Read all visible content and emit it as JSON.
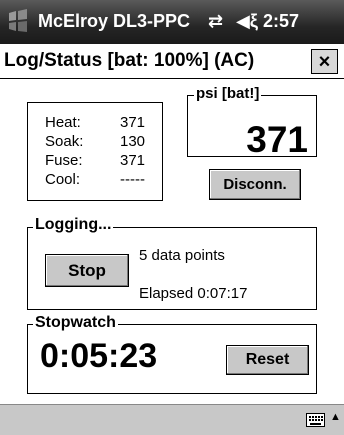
{
  "titlebar": {
    "title": "McElroy DL3-PPC",
    "connection_icon": "⇄",
    "volume_icon": "◀ξ",
    "time": "2:57"
  },
  "header": {
    "title": "Log/Status  [bat: 100%] (AC)",
    "close_label": "×"
  },
  "stats": [
    {
      "label": "Heat:",
      "value": "371"
    },
    {
      "label": "Soak:",
      "value": "130"
    },
    {
      "label": "Fuse:",
      "value": "371"
    },
    {
      "label": "Cool:",
      "value": "-----"
    }
  ],
  "psi": {
    "legend": "psi [bat!]",
    "value": "371"
  },
  "disconnect_label": "Disconn.",
  "logging": {
    "legend": "Logging...",
    "stop_label": "Stop",
    "data_points": "5 data points",
    "elapsed": "Elapsed 0:07:17"
  },
  "stopwatch": {
    "legend": "Stopwatch",
    "time": "0:05:23",
    "reset_label": "Reset"
  },
  "bottombar": {
    "arrow": "▲"
  }
}
